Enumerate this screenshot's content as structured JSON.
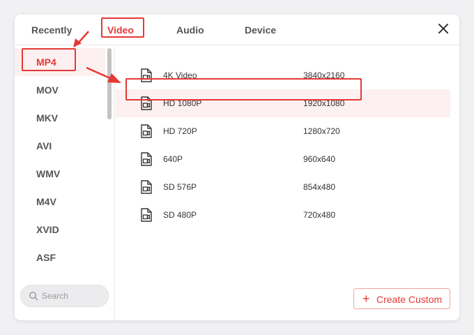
{
  "tabs": [
    "Recently",
    "Video",
    "Audio",
    "Device"
  ],
  "active_tab": "Video",
  "close_glyph": "✕",
  "formats": [
    "MP4",
    "MOV",
    "MKV",
    "AVI",
    "WMV",
    "M4V",
    "XVID",
    "ASF"
  ],
  "active_format": "MP4",
  "search": {
    "placeholder": "Search"
  },
  "presets": [
    {
      "name": "4K Video",
      "resolution": "3840x2160"
    },
    {
      "name": "HD 1080P",
      "resolution": "1920x1080"
    },
    {
      "name": "HD 720P",
      "resolution": "1280x720"
    },
    {
      "name": "640P",
      "resolution": "960x640"
    },
    {
      "name": "SD 576P",
      "resolution": "854x480"
    },
    {
      "name": "SD 480P",
      "resolution": "720x480"
    }
  ],
  "selected_preset": "HD 1080P",
  "create_button": {
    "icon": "+",
    "label": "Create Custom"
  },
  "colors": {
    "accent": "#e53935",
    "accent_soft": "#fdf0f0",
    "panel": "#ffffff",
    "background": "#f1f1f3"
  },
  "icons": {
    "preset": "video-file-icon",
    "search": "search-icon",
    "close": "close-icon"
  }
}
